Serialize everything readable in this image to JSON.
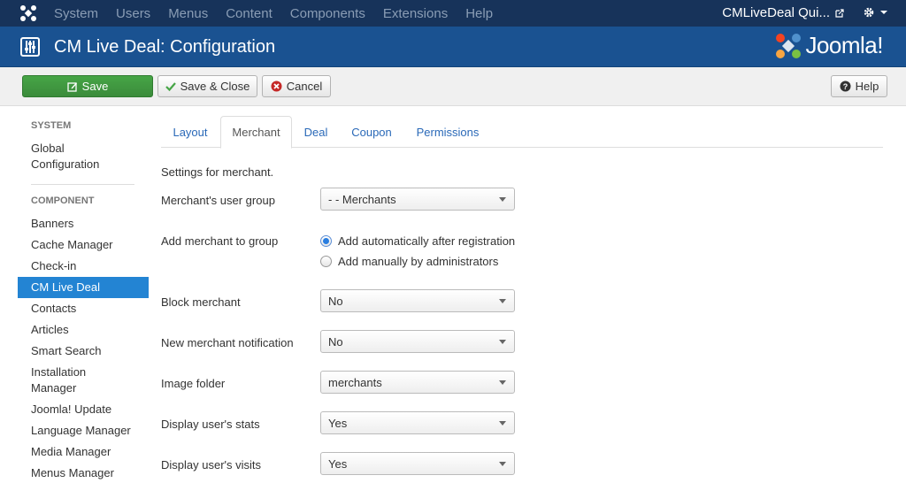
{
  "topnav": {
    "menu": [
      "System",
      "Users",
      "Menus",
      "Content",
      "Components",
      "Extensions",
      "Help"
    ],
    "site_name": "CMLiveDeal Qui..."
  },
  "header": {
    "title": "CM Live Deal: Configuration",
    "logo_text": "Joomla!"
  },
  "toolbar": {
    "save": "Save",
    "save_close": "Save & Close",
    "cancel": "Cancel",
    "help": "Help"
  },
  "sidebar": {
    "system_heading": "SYSTEM",
    "global_config": [
      "Global",
      "Configuration"
    ],
    "component_heading": "COMPONENT",
    "items": [
      "Banners",
      "Cache Manager",
      "Check-in",
      "CM Live Deal",
      "Contacts",
      "Articles",
      "Smart Search",
      "Installation",
      "Manager",
      "Joomla! Update",
      "Language Manager",
      "Media Manager",
      "Menus Manager"
    ]
  },
  "tabs": [
    "Layout",
    "Merchant",
    "Deal",
    "Coupon",
    "Permissions"
  ],
  "form": {
    "intro": "Settings for merchant.",
    "user_group_label": "Merchant's user group",
    "user_group_value": "- - Merchants",
    "add_group_label": "Add merchant to group",
    "radio_auto": "Add automatically after registration",
    "radio_manual": "Add manually by administrators",
    "block_label": "Block merchant",
    "block_value": "No",
    "notify_label": "New merchant notification",
    "notify_value": "No",
    "image_folder_label": "Image folder",
    "image_folder_value": "merchants",
    "stats_label": "Display user's stats",
    "stats_value": "Yes",
    "visits_label": "Display user's visits",
    "visits_value": "Yes"
  },
  "colors": {
    "topnav": "#17335a",
    "header": "#1a5291",
    "save_green": "#46a546",
    "active_blue": "#2384d3",
    "link": "#2a69b8"
  }
}
